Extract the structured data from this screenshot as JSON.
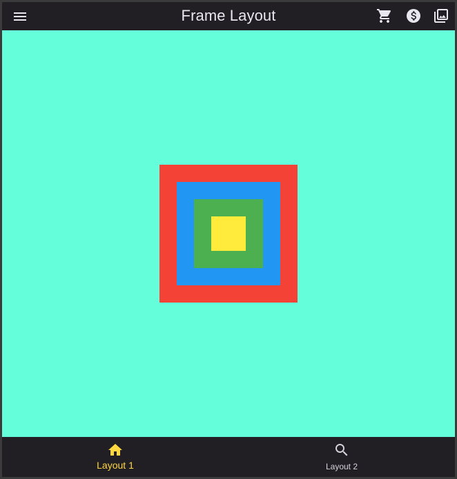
{
  "app_bar": {
    "title": "Frame Layout",
    "menu_icon": "menu-icon",
    "actions": [
      {
        "icon": "shopping-cart-icon"
      },
      {
        "icon": "dollar-circle-icon"
      },
      {
        "icon": "photo-library-icon"
      }
    ],
    "background": "#211f24",
    "foreground": "#e8e6ee"
  },
  "content": {
    "background": "#64ffda",
    "frame_squares": [
      {
        "name": "red-square",
        "color": "#f44336"
      },
      {
        "name": "blue-square",
        "color": "#2196f3"
      },
      {
        "name": "green-square",
        "color": "#4caf50"
      },
      {
        "name": "yellow-square",
        "color": "#ffeb3b"
      }
    ]
  },
  "bottom_nav": {
    "items": [
      {
        "label": "Layout 1",
        "icon": "home-icon",
        "active": true
      },
      {
        "label": "Layout 2",
        "icon": "search-icon",
        "active": false
      }
    ],
    "active_color": "#ffd740",
    "inactive_color": "#d6d4dc"
  }
}
